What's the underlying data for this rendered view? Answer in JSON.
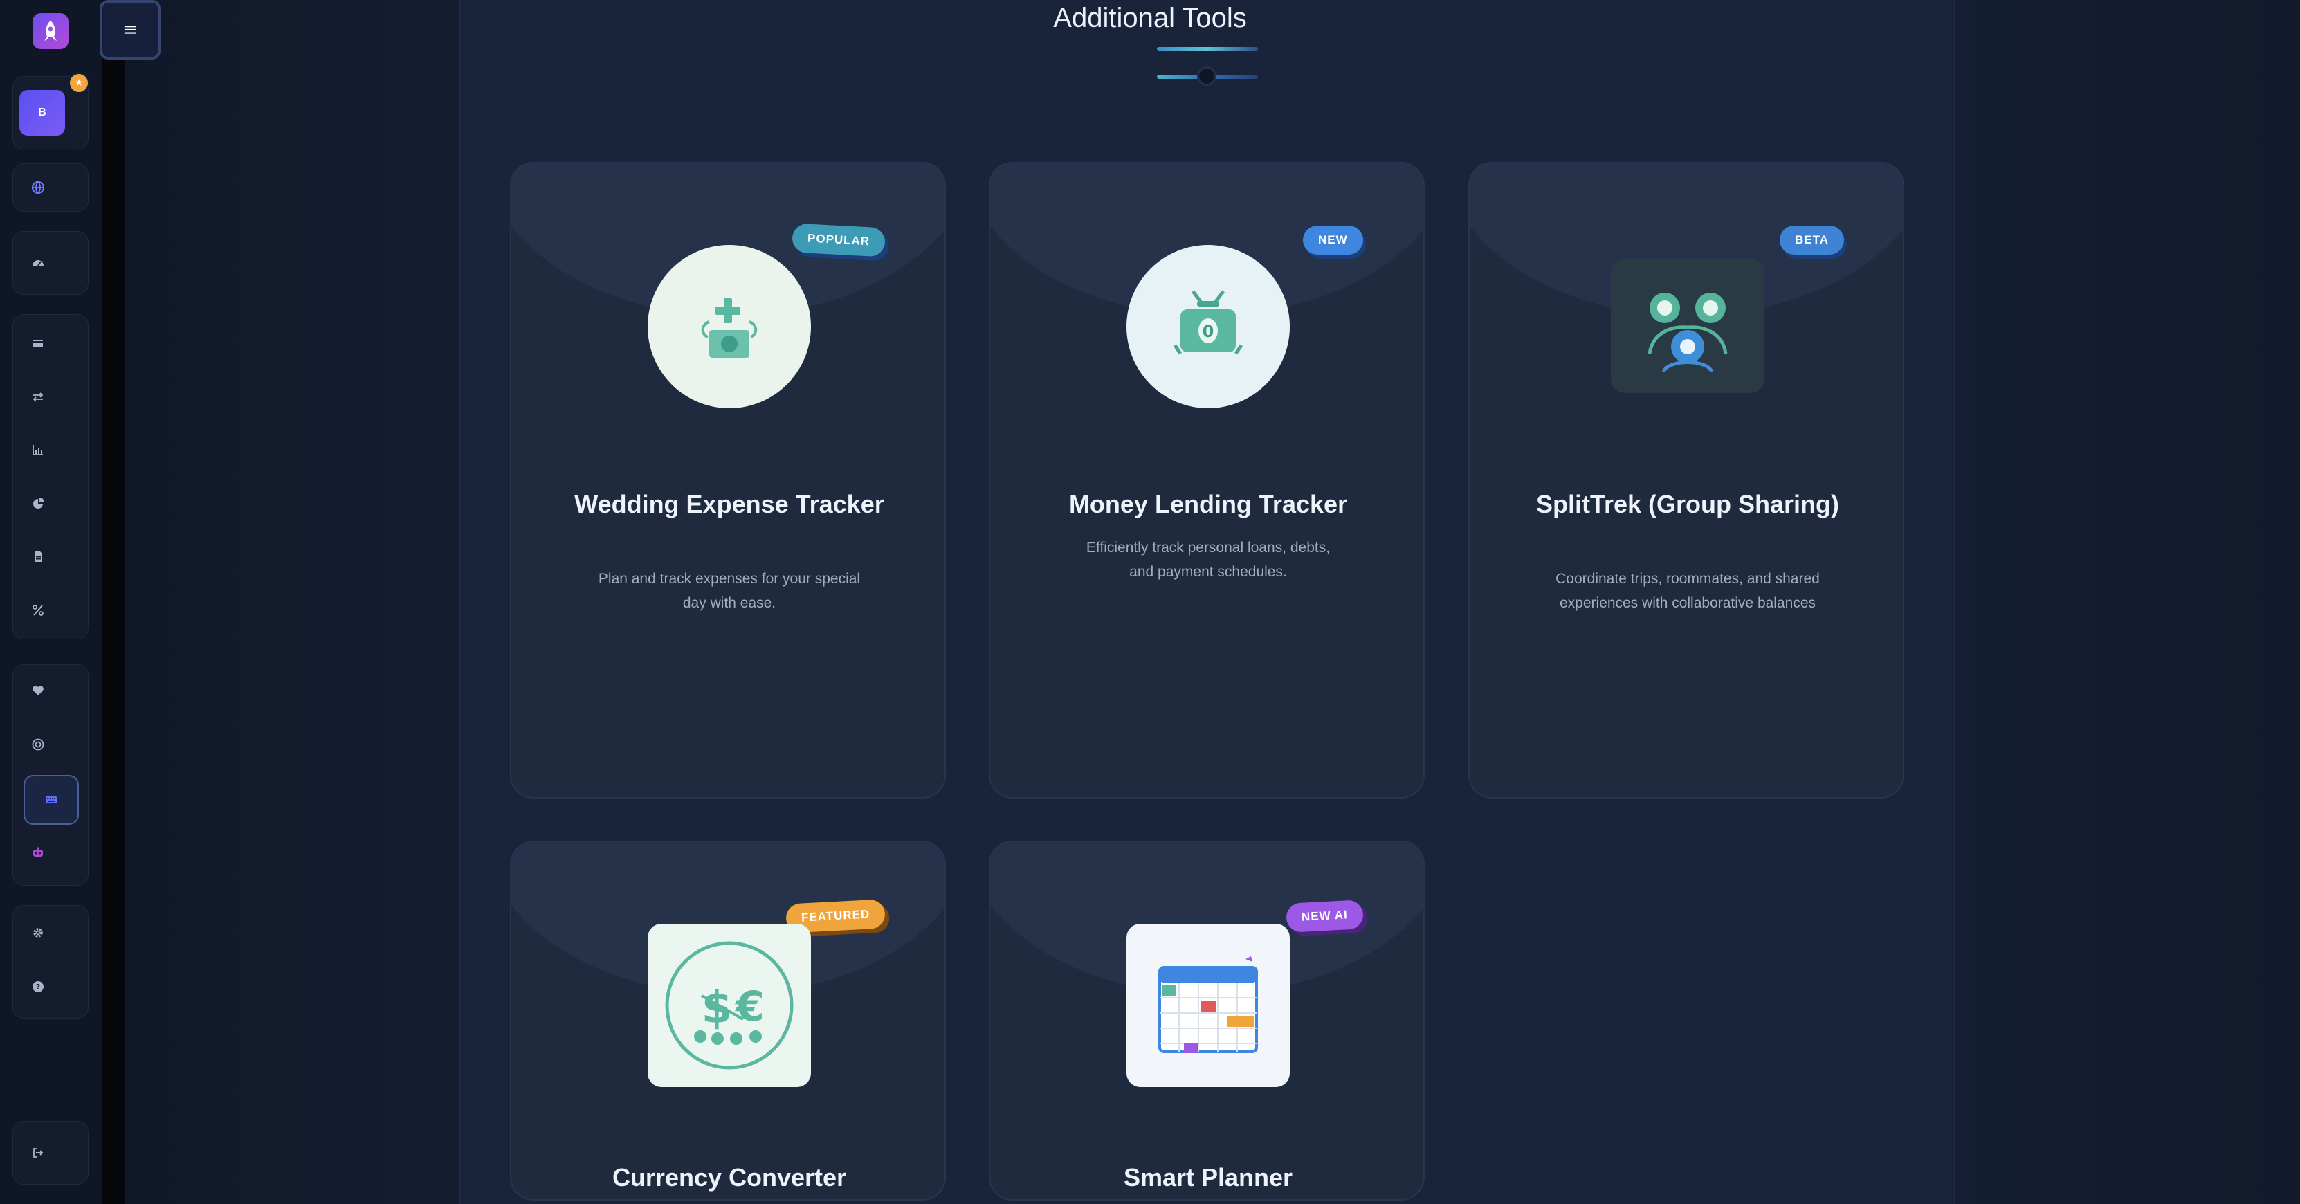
{
  "menu_toggle": {
    "glyph": "≡"
  },
  "sidebar": {
    "logo_icon": "rocket-icon",
    "avatar_initial": "B",
    "avatar_badge": "★",
    "items": [
      {
        "name": "globe",
        "icon": "globe-icon"
      },
      {
        "name": "dashboard",
        "icon": "gauge-icon"
      },
      {
        "name": "wallet",
        "icon": "wallet-icon"
      },
      {
        "name": "transfer",
        "icon": "exchange-icon"
      },
      {
        "name": "analytics",
        "icon": "bar-chart-icon"
      },
      {
        "name": "reports",
        "icon": "pie-chart-icon"
      },
      {
        "name": "invoices",
        "icon": "file-icon"
      },
      {
        "name": "tax",
        "icon": "percent-icon"
      },
      {
        "name": "health",
        "icon": "heart-pulse-icon"
      },
      {
        "name": "goals",
        "icon": "target-icon"
      },
      {
        "name": "tools",
        "icon": "keyboard-icon",
        "active": true
      },
      {
        "name": "ai",
        "icon": "robot-icon"
      },
      {
        "name": "settings",
        "icon": "gear-icon"
      },
      {
        "name": "help",
        "icon": "question-icon"
      },
      {
        "name": "logout",
        "icon": "logout-icon"
      }
    ]
  },
  "section": {
    "title": "Additional Tools"
  },
  "colors": {
    "accent_teal": "#5ab8b0",
    "badge_popular": "#3d9bb5",
    "badge_new": "#3f86e0",
    "badge_beta": "#3f84d4",
    "badge_featured": "#f0a53c",
    "badge_new_ai": "#9b59e6"
  },
  "cards": [
    {
      "title": "Wedding Expense Tracker",
      "badge": "POPULAR",
      "description": "Plan and track expenses for your special day with ease.",
      "icon": "wedding-money-icon"
    },
    {
      "title": "Money Lending Tracker",
      "badge": "NEW",
      "description": "Efficiently track personal loans, debts, and payment schedules.",
      "icon": "money-bag-icon"
    },
    {
      "title": "SplitTrek (Group Sharing)",
      "badge": "BETA",
      "description": "Coordinate trips, roommates, and shared experiences with collaborative balances",
      "icon": "group-users-icon"
    },
    {
      "title": "Currency Converter",
      "badge": "FEATURED",
      "description": "",
      "icon": "currency-exchange-icon"
    },
    {
      "title": "Smart Planner",
      "badge": "NEW AI",
      "description": "",
      "icon": "calendar-icon"
    }
  ]
}
